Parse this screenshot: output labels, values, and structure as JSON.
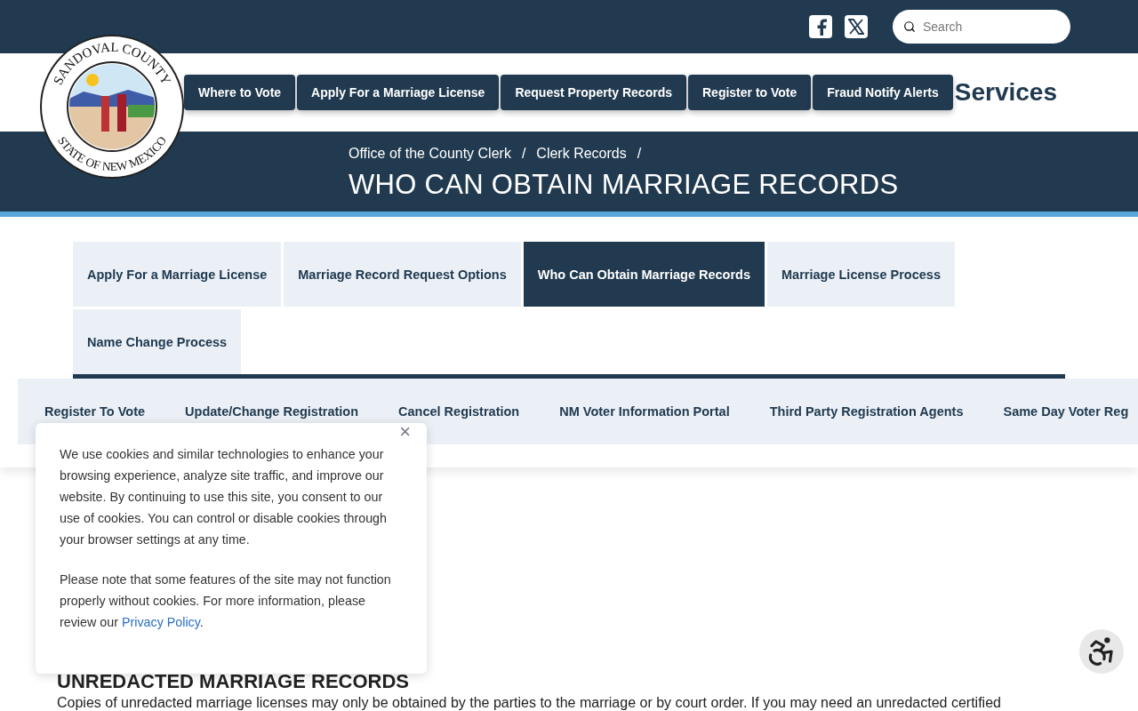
{
  "top_bar": {
    "social": [
      {
        "kind": "facebook"
      },
      {
        "kind": "x"
      }
    ],
    "search": {
      "placeholder": "Search"
    }
  },
  "logo": {
    "top_text": "SANDOVAL COUNTY",
    "bottom_text": "STATE OF NEW MEXICO"
  },
  "main_nav": [
    "Where to Vote",
    "Apply For a Marriage License",
    "Request Property Records",
    "Register to Vote",
    "Fraud Notify Alerts"
  ],
  "nav_heading": "Services",
  "breadcrumbs": [
    {
      "label": "Office of the County Clerk",
      "separator": "/"
    },
    {
      "label": "Clerk Records",
      "separator": "/"
    }
  ],
  "page_title": "WHO CAN OBTAIN MARRIAGE RECORDS",
  "tabs": [
    {
      "label": "Apply For a Marriage License",
      "selected": false
    },
    {
      "label": "Marriage Record Request Options",
      "selected": false
    },
    {
      "label": "Who Can Obtain Marriage Records",
      "selected": true
    },
    {
      "label": "Marriage License Process",
      "selected": false
    },
    {
      "label": "Name Change Process",
      "selected": false
    }
  ],
  "voter_nav": [
    "Register To Vote",
    "Update/Change Registration",
    "Cancel Registration",
    "NM Voter Information Portal",
    "Third Party Registration Agents",
    "Same Day Voter Reg"
  ],
  "cookie_notice": {
    "paragraphs": [
      "We use cookies and similar technologies to enhance your browsing experience, analyze site traffic, and improve our website. By continuing to use this site, you consent to our use of cookies. You can control or disable cookies through your browser settings at any time.",
      "Please note that some features of the site may not function properly without cookies. For more information, please review our"
    ],
    "link": "Privacy Policy",
    "link_suffix": ".",
    "close": "×"
  },
  "section": {
    "heading": "UNREDACTED MARRIAGE RECORDS",
    "text": "Copies of unredacted marriage licenses may only be obtained by the parties to the marriage or by court order. If you may need an unredacted certified"
  }
}
